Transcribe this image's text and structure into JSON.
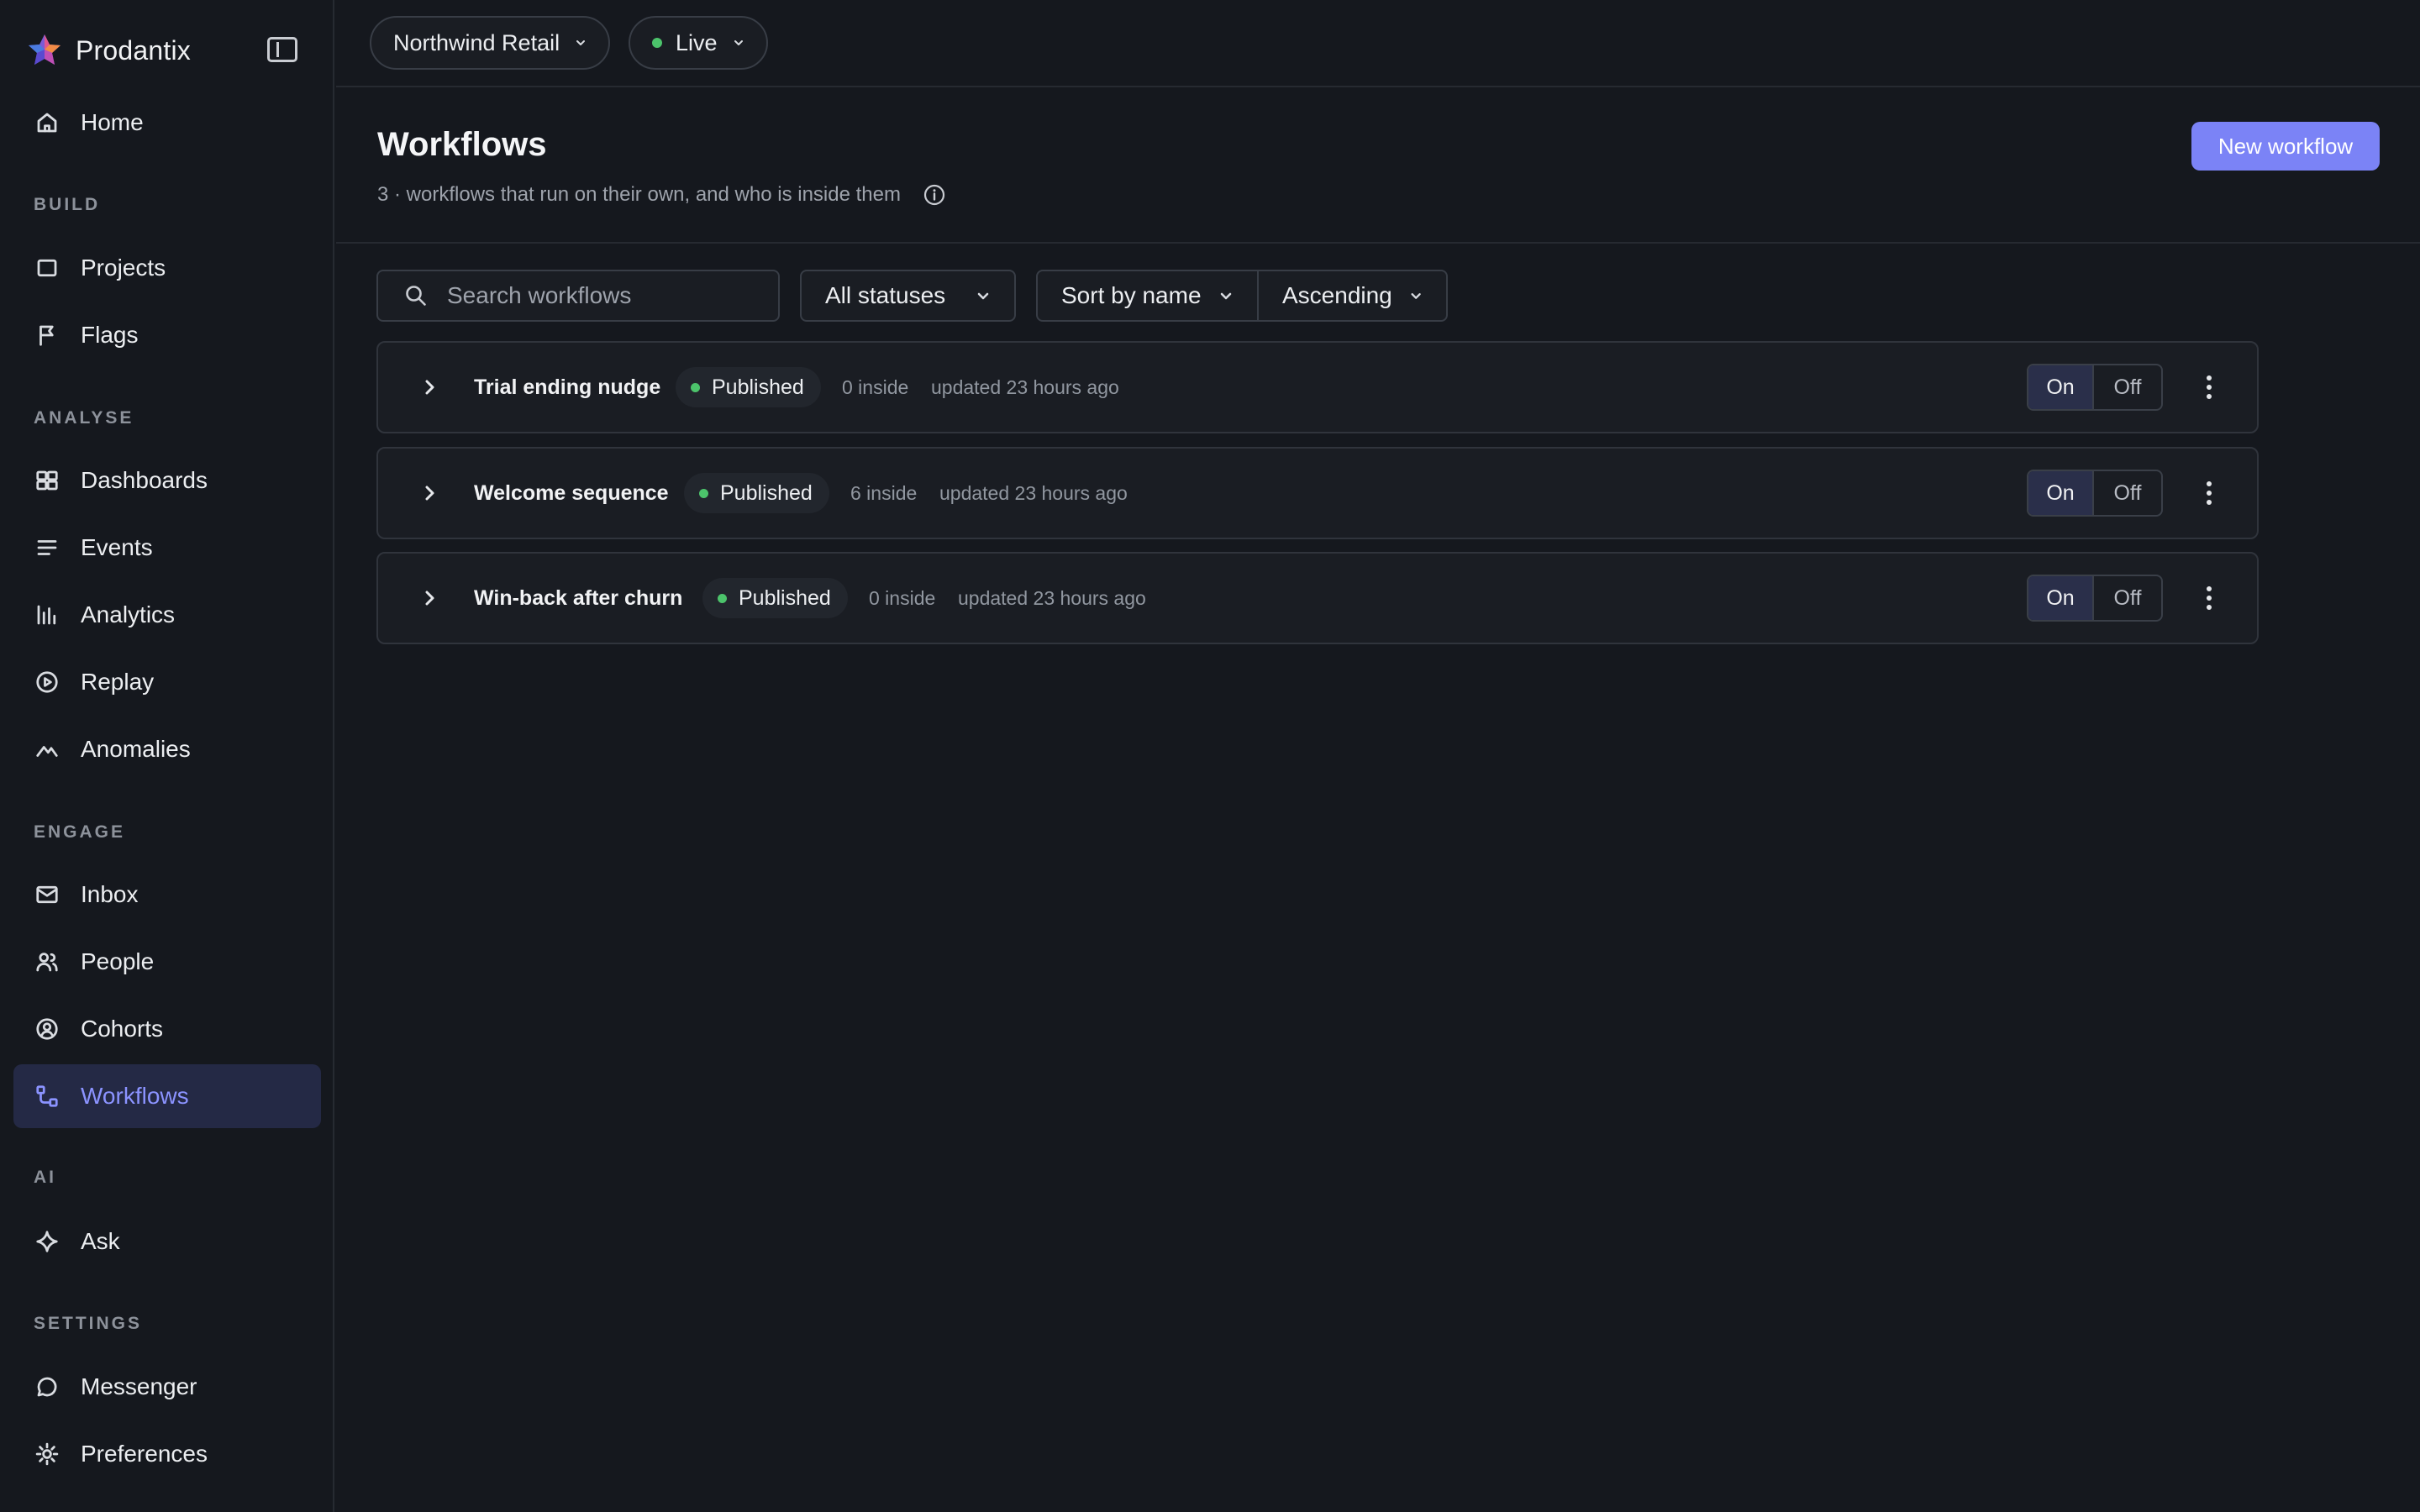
{
  "app": {
    "name": "Prodantix"
  },
  "sidebar": {
    "home": "Home",
    "sections": {
      "build": "BUILD",
      "analyse": "ANALYSE",
      "engage": "ENGAGE",
      "ai": "AI",
      "settings": "SETTINGS"
    },
    "items": {
      "projects": "Projects",
      "flags": "Flags",
      "dashboards": "Dashboards",
      "events": "Events",
      "analytics": "Analytics",
      "replay": "Replay",
      "anomalies": "Anomalies",
      "inbox": "Inbox",
      "people": "People",
      "cohorts": "Cohorts",
      "workflows": "Workflows",
      "ask": "Ask",
      "messenger": "Messenger",
      "preferences": "Preferences"
    },
    "active": "Workflows",
    "accent_color": "#8b93ff"
  },
  "topbar": {
    "workspace": "Northwind Retail",
    "environment": "Live",
    "environment_status_color": "#4cc36b"
  },
  "header": {
    "title": "Workflows",
    "subtitle": "3 · workflows that run on their own, and who is inside them",
    "new_button": "New workflow",
    "button_color": "#7b83f6"
  },
  "filters": {
    "search_placeholder": "Search workflows",
    "status": "All statuses",
    "sort": "Sort by name",
    "order": "Ascending"
  },
  "workflows": [
    {
      "name": "Trial ending nudge",
      "status": "Published",
      "inside": "0 inside",
      "updated": "updated 23 hours ago",
      "toggle_on": "On",
      "toggle_off": "Off"
    },
    {
      "name": "Welcome sequence",
      "status": "Published",
      "inside": "6 inside",
      "updated": "updated 23 hours ago",
      "toggle_on": "On",
      "toggle_off": "Off"
    },
    {
      "name": "Win-back after churn",
      "status": "Published",
      "inside": "0 inside",
      "updated": "updated 23 hours ago",
      "toggle_on": "On",
      "toggle_off": "Off"
    }
  ]
}
